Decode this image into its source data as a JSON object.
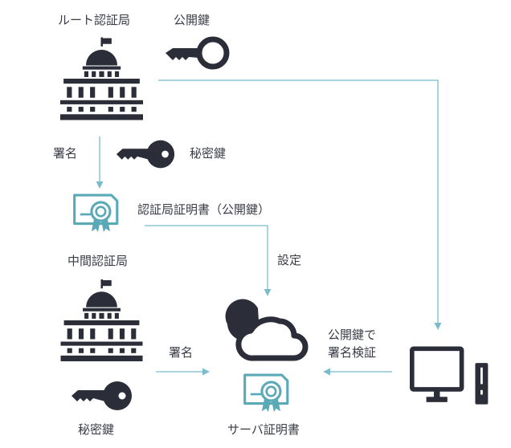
{
  "labels": {
    "root_ca": "ルート認証局",
    "public_key_top": "公開鍵",
    "sign_top": "署名",
    "private_key_top": "秘密鍵",
    "ca_cert": "認証局証明書（公開鍵）",
    "setting": "設定",
    "intermediate_ca": "中間認証局",
    "verify_line1": "公開鍵で",
    "verify_line2": "署名検証",
    "sign_bottom": "署名",
    "private_key_bottom": "秘密鍵",
    "server_cert": "サーバ証明書"
  },
  "icons": {
    "root_ca": "building-icon",
    "public_key": "key-icon",
    "private_key_top": "key-icon",
    "ca_certificate": "certificate-icon",
    "intermediate_ca": "building-icon",
    "private_key_bottom": "key-icon",
    "server_cloud": "cloud-icon",
    "server_certificate": "certificate-icon",
    "client_computer": "computer-icon"
  },
  "colors": {
    "icon_dark": "#2b2e38",
    "icon_teal": "#5aa9b7",
    "arrow": "#79bccb",
    "text": "#3a3d47"
  }
}
